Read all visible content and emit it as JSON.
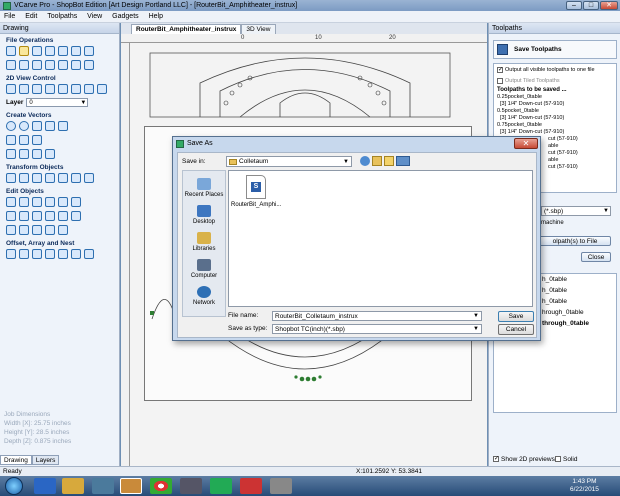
{
  "window": {
    "title": "VCarve Pro - ShopBot Edition [Art Design Portland LLC] - [RouterBit_Amphitheater_instrux]",
    "minimize": "–",
    "maximize": "□",
    "close": "✕"
  },
  "menu": [
    "File",
    "Edit",
    "Toolpaths",
    "View",
    "Gadgets",
    "Help"
  ],
  "left_panel": {
    "header": "Drawing",
    "sections": {
      "file_operations": "File Operations",
      "view_control": "2D View Control",
      "create_vectors": "Create Vectors",
      "transform_objects": "Transform Objects",
      "edit_objects": "Edit Objects",
      "offset_array_nest": "Offset, Array and Nest"
    },
    "layer_label": "Layer",
    "layer_value": "0",
    "job_dimensions": {
      "title": "Job Dimensions",
      "width": "Width  [X]: 25.75 inches",
      "height": "Height [Y]: 28.5 inches",
      "depth": "Depth  [Z]: 0.875 inches"
    },
    "bottom_tabs": [
      "Drawing",
      "Layers"
    ]
  },
  "document": {
    "tabs": [
      "RouterBit_Amphitheater_instrux",
      "3D View"
    ],
    "ruler_top": [
      "0",
      "10",
      "20"
    ]
  },
  "right_panel": {
    "header": "Toolpaths",
    "save_title": "Save Toolpaths",
    "options": [
      {
        "label": "Output all visible toolpaths to one file",
        "checked": true
      },
      {
        "label": "Output Tiled Toolpaths",
        "checked": false
      }
    ],
    "tp_to_save_label": "Toolpaths to be saved ...",
    "tp_lines": [
      "0.25pocket_0table",
      "[3] 1/4\" Down-cut (57-910)",
      "0.5pocket_0table",
      "[3] 1/4\" Down-cut (57-910)",
      "0.75pocket_0table",
      "[3] 1/4\" Down-cut (57-910)",
      "cut (57-910)",
      "able",
      "cut (57-910)",
      "able",
      "cut (57-910)"
    ],
    "format_value": "(*.sbp)",
    "machine_label": "machine",
    "save_button": "olpath(s) to File",
    "close_button": "Close",
    "list_items": [
      "h_0table",
      "h_0table",
      "h_0table",
      "hrough_0table",
      "through_0table"
    ],
    "show_previews": "Show 2D previews",
    "solid": "Solid"
  },
  "dialog": {
    "title": "Save As",
    "save_in_label": "Save in:",
    "save_in_value": "Colletaum",
    "places": [
      "Recent Places",
      "Desktop",
      "Libraries",
      "Computer",
      "Network"
    ],
    "file_item": "RouterBit_Amphi...",
    "file_icon_letter": "S",
    "file_name_label": "File name:",
    "file_name_value": "RouterBit_Colletaum_instrux",
    "save_type_label": "Save as type:",
    "save_type_value": "Shopbot TC(inch)(*.sbp)",
    "save_button": "Save",
    "cancel_button": "Cancel"
  },
  "status": {
    "left": "Ready",
    "coords": "X:101.2592 Y: 53.3841"
  },
  "taskbar": {
    "time": "1:43 PM",
    "date": "6/22/2015"
  }
}
